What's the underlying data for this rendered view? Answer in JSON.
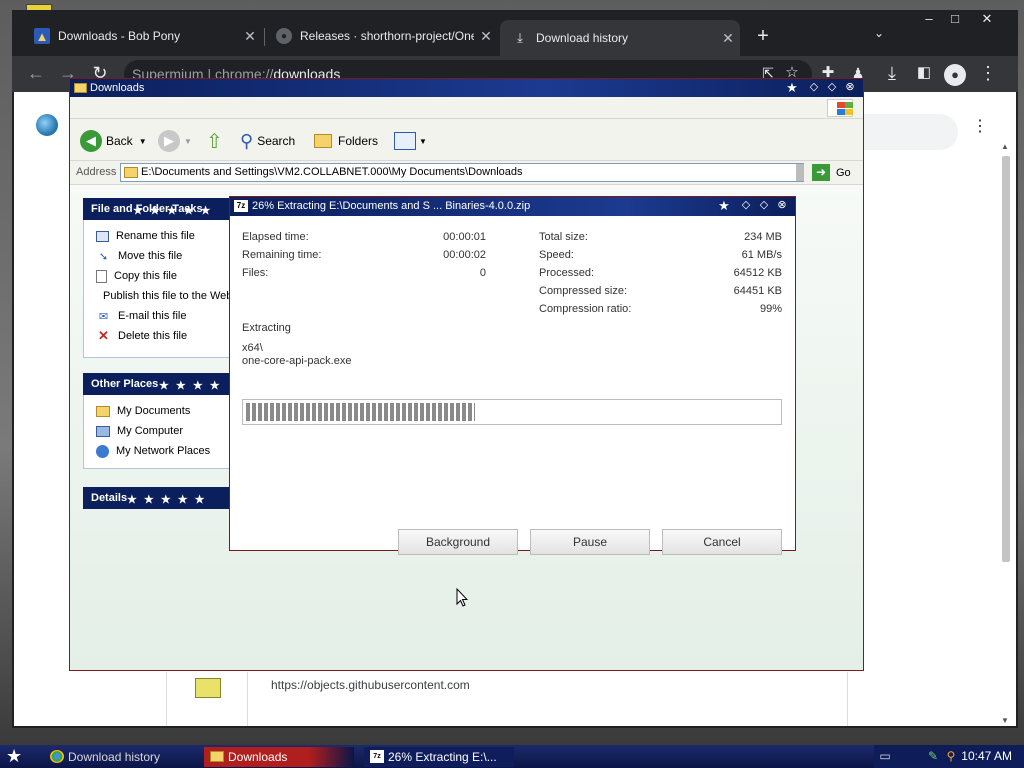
{
  "chrome": {
    "tabs": [
      {
        "title": "Downloads - Bob Pony",
        "active": false
      },
      {
        "title": "Releases · shorthorn-project/One-C",
        "active": false
      },
      {
        "title": "Download history",
        "active": true
      }
    ],
    "new_tab_glyph": "+",
    "close_glyph": "✕",
    "omnibox": {
      "site_label": "Supermium",
      "separator": " | ",
      "scheme": "chrome://",
      "path": "downloads"
    },
    "download_url": "https://objects.githubusercontent.com"
  },
  "explorer": {
    "title": "Downloads",
    "toolbar": {
      "back": "Back",
      "search": "Search",
      "folders": "Folders"
    },
    "address_label": "Address",
    "address_value": "E:\\Documents and Settings\\VM2.COLLABNET.000\\My Documents\\Downloads",
    "go_label": "Go",
    "panels": {
      "file_tasks": {
        "title": "File and Folder Tasks",
        "items": [
          "Rename this file",
          "Move this file",
          "Copy this file",
          "Publish this file to the Web",
          "E-mail this file",
          "Delete this file"
        ]
      },
      "other_places": {
        "title": "Other Places",
        "items": [
          "My Documents",
          "My Computer",
          "My Network Places"
        ]
      },
      "details": {
        "title": "Details"
      }
    }
  },
  "zip": {
    "title": "26% Extracting E:\\Documents and S ... Binaries-4.0.0.zip",
    "progress_fraction": 0.43,
    "left_stats": [
      {
        "label": "Elapsed time:",
        "value": "00:00:01"
      },
      {
        "label": "Remaining time:",
        "value": "00:00:02"
      },
      {
        "label": "Files:",
        "value": "0"
      }
    ],
    "right_stats": [
      {
        "label": "Total size:",
        "value": "234 MB"
      },
      {
        "label": "Speed:",
        "value": "61 MB/s"
      },
      {
        "label": "Processed:",
        "value": "64512 KB"
      },
      {
        "label": "Compressed size:",
        "value": "64451 KB"
      },
      {
        "label": "Compression ratio:",
        "value": "99%"
      }
    ],
    "status_label": "Extracting",
    "current_folder": "x64\\",
    "current_file": "one-core-api-pack.exe",
    "buttons": {
      "background": "Background",
      "pause": "Pause",
      "cancel": "Cancel"
    }
  },
  "taskbar": {
    "items": [
      "Download history",
      "Downloads",
      "26% Extracting E:\\..."
    ],
    "clock": "10:47 AM"
  }
}
